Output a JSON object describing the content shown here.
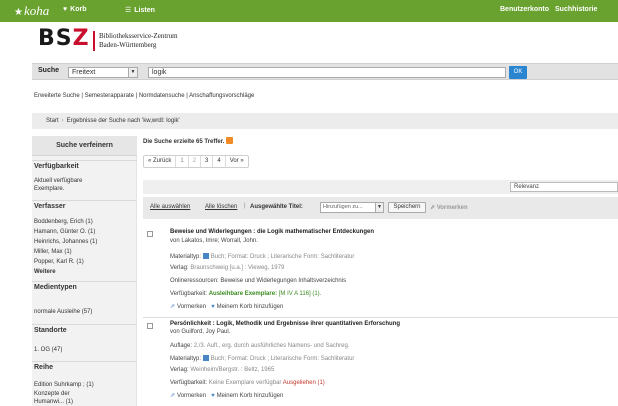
{
  "nav": {
    "logo_star": "★",
    "logo": "koha",
    "cart_icon": "♥",
    "cart": "Korb",
    "lists_icon": "☰",
    "lists": "Listen",
    "account": "Benutzerkonto",
    "history": "Suchhistorie"
  },
  "header": {
    "logo_bs": "BS",
    "logo_z": "Z",
    "name_line1": "Bibliotheksservice-Zentrum",
    "name_line2": "Baden-Württemberg"
  },
  "search": {
    "label": "Suche",
    "scope": "Freitext",
    "query": "logik",
    "ok": "OK"
  },
  "secondary_links": "Erweiterte Suche | Semesterapparate | Normdatensuche | Anschaffungsvorschläge",
  "breadcrumb": {
    "home": "Start",
    "current": "Ergebnisse der Suche nach 'kw,wrdl: logik'"
  },
  "sidebar": {
    "refine": "Suche verfeinern",
    "availability_head": "Verfügbarkeit",
    "availability_items": [
      "Aktuell verfügbare",
      "Exemplare."
    ],
    "authors_head": "Verfasser",
    "authors": [
      "Boddenberg, Erich (1)",
      "Hamann, Günter O. (1)",
      "Heinrichs, Johannes (1)",
      "Miller, Max (1)",
      "Popper, Karl R. (1)"
    ],
    "more": "Weitere",
    "media_head": "Medientypen",
    "media": [
      "normale Ausleihe (57)"
    ],
    "locations_head": "Standorte",
    "locations": [
      "1. OG (47)"
    ],
    "series_head": "Reihe",
    "series": [
      "Edition Suhrkamp ; (1)",
      "Konzepte der",
      "Humanwi... (1)"
    ]
  },
  "results": {
    "summary": "Die Suche erzielte 65 Treffer.",
    "pager": [
      "« Zurück",
      "1",
      "2",
      "3",
      "4",
      "Vor »"
    ],
    "sort": "Relevanz",
    "select_all": "Alle auswählen",
    "clear_all": "Alle löschen",
    "selected_titles": "Ausgewählte Titel:",
    "add_to": "Hinzufügen zu...",
    "save": "Speichern",
    "reserve_selected": "Vormerken",
    "items": [
      {
        "title": "Beweise und Widerlegungen : die Logik mathematischer Entdeckungen",
        "author": "von Lakatos, Imre; Worrall, John.",
        "type_label": "Materialtyp:",
        "type_value": "Buch; Format: Druck ; Literarische Form: Sachliteratur",
        "publisher_label": "Verlag:",
        "publisher_value": "Braunschweig [u.a.] : Vieweg, 1979",
        "online": "Onlineressourcen: Beweise und Widerlegungen Inhaltsverzeichnis",
        "avail_label": "Verfügbarkeit:",
        "avail_green": "Ausleihbare Exemplare:",
        "avail_rest": "[M IV A 116] (1).",
        "reserve": "Vormerken",
        "add_cart": "Meinem Korb hinzufügen"
      },
      {
        "title": "Persönlichkeit : Logik, Methodik und Ergebnisse ihrer quantitativen Erforschung",
        "author": "von Guilford, Joy Paul.",
        "edition_label": "Auflage:",
        "edition_value": "2./3. Aufl., erg. durch ausführliches Namens- und Sachreg.",
        "type_label": "Materialtyp:",
        "type_value": "Buch; Format: Druck ; Literarische Form: Sachliteratur",
        "publisher_label": "Verlag:",
        "publisher_value": "Weinheim/Bergstr. : Beltz, 1965",
        "avail_label": "Verfügbarkeit:",
        "avail_muted": "Keine Exemplare verfügbar",
        "avail_red": "Ausgeliehen (1)",
        "reserve": "Vormerken",
        "add_cart": "Meinem Korb hinzufügen"
      }
    ]
  }
}
